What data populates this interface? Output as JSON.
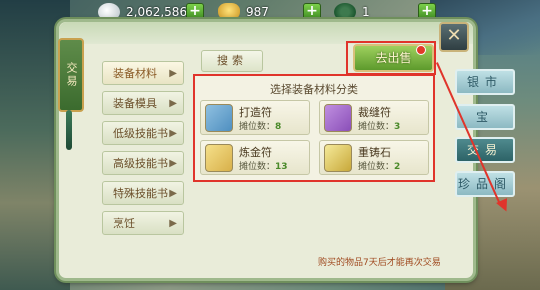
{
  "topbar": {
    "silver": {
      "value": "2,062,586",
      "icon": "silver-coin-icon"
    },
    "gold": {
      "value": "987",
      "icon": "gold-ingot-icon"
    },
    "jade": {
      "value": "1",
      "icon": "jade-icon"
    },
    "plus_label": "+"
  },
  "side_banner": {
    "label": "交易"
  },
  "close_label": "✕",
  "categories": [
    {
      "label": "装备材料",
      "active": true
    },
    {
      "label": "装备模具",
      "active": false
    },
    {
      "label": "低级技能书",
      "active": false
    },
    {
      "label": "高级技能书",
      "active": false
    },
    {
      "label": "特殊技能书",
      "active": false
    },
    {
      "label": "烹饪",
      "active": false
    }
  ],
  "category_arrow": "▶",
  "search": {
    "label": "搜索"
  },
  "sell_button": {
    "label": "去出售"
  },
  "material_section": {
    "title": "选择装备材料分类",
    "stall_label": "摊位数：",
    "items": [
      {
        "name": "打造符",
        "count": "8",
        "icon": "forge-talisman-icon",
        "color": "#4f8fc0"
      },
      {
        "name": "裁缝符",
        "count": "3",
        "icon": "tailor-talisman-icon",
        "color": "#8a4fb8"
      },
      {
        "name": "炼金符",
        "count": "13",
        "icon": "alchemy-talisman-icon",
        "color": "#d8b04a"
      },
      {
        "name": "重铸石",
        "count": "2",
        "icon": "recast-stone-icon",
        "color": "#d8c04a"
      }
    ]
  },
  "footer_note": "购买的物品7天后才能再次交易",
  "right_menu": [
    {
      "label": "银市",
      "active": false
    },
    {
      "label": "宝",
      "active": false
    },
    {
      "label": "交易",
      "active": true
    },
    {
      "label": "珍品阁",
      "active": false
    }
  ]
}
